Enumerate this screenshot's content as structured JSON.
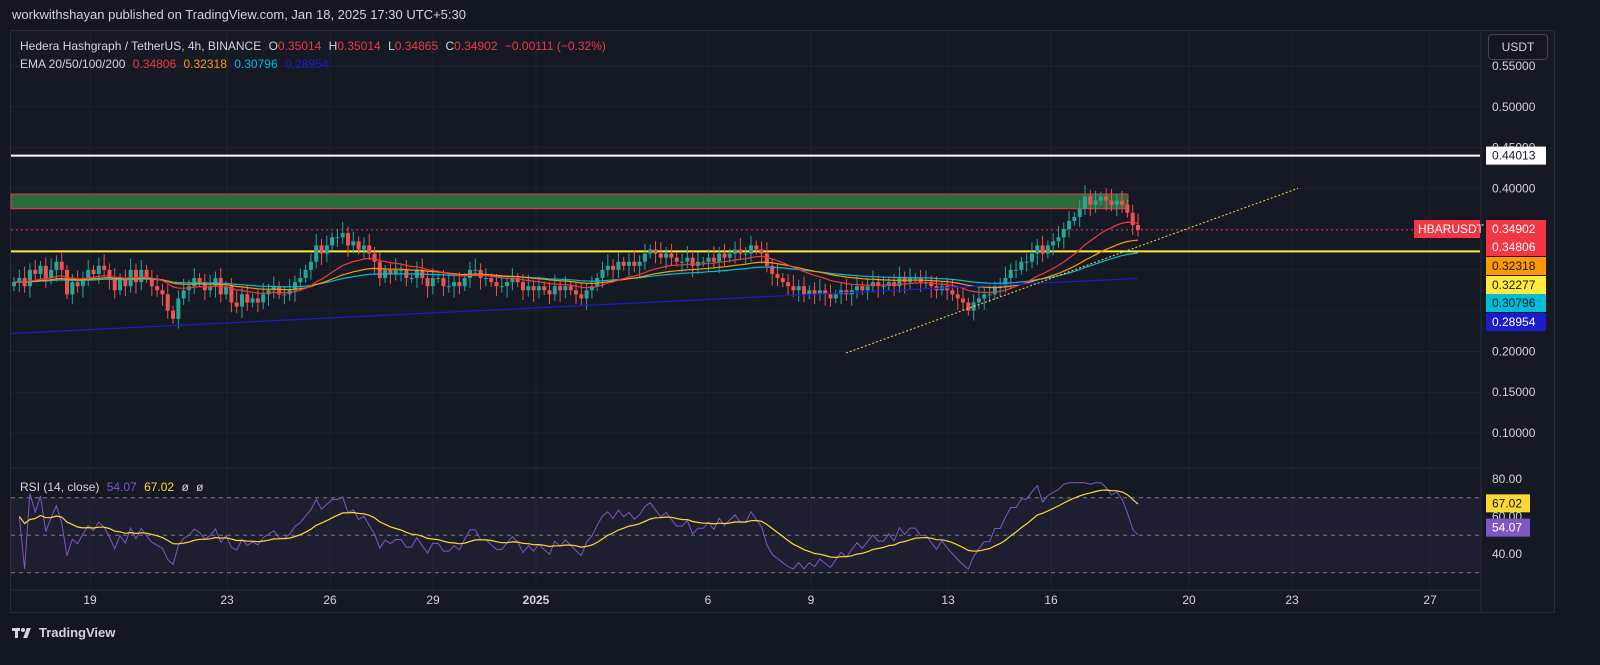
{
  "header": {
    "published_text": "workwithshayan published on TradingView.com, Jan 18, 2025 17:30 UTC+5:30"
  },
  "legend": {
    "symbol": "Hedera Hashgraph / TetherUS, 4h, BINANCE",
    "o_label": "O",
    "o_value": "0.35014",
    "h_label": "H",
    "h_value": "0.35014",
    "l_label": "L",
    "l_value": "0.34865",
    "c_label": "C",
    "c_value": "0.34902",
    "change": "−0.00111 (−0.32%)",
    "ema_label": "EMA 20/50/100/200",
    "ema20": "0.34806",
    "ema50": "0.32318",
    "ema100": "0.30796",
    "ema200": "0.28954"
  },
  "unit_button": "USDT",
  "rsi_legend": {
    "label": "RSI (14, close)",
    "rsi": "54.07",
    "ma": "67.02",
    "v3": "ø",
    "v4": "ø"
  },
  "footer": {
    "brand": "TradingView"
  },
  "colors": {
    "up": "#26a69a",
    "down": "#ef5350",
    "ema20": "#f23645",
    "ema50": "#ff9800",
    "ema100": "#00bcd4",
    "ema200": "#1c1ccf",
    "rsi": "#7e57c2",
    "rsi_ma": "#fdd835"
  },
  "chart_data": {
    "type": "candlestick",
    "x_ticks": [
      "19",
      "23",
      "26",
      "29",
      "2025",
      "6",
      "9",
      "13",
      "16",
      "20",
      "23",
      "27"
    ],
    "y_ticks": [
      "0.55000",
      "0.50000",
      "0.45000",
      "0.40000",
      "0.10000",
      "0.15000",
      "0.20000"
    ],
    "y_ticks_note": "",
    "price_axis": [
      "0.55000",
      "0.50000",
      "0.45000",
      "0.40000",
      "0.20000",
      "0.15000",
      "0.10000"
    ],
    "ylim": [
      0.07,
      0.57
    ],
    "horizontal_lines": [
      {
        "price": 0.44013,
        "label": "0.44013",
        "color": "#ffffff"
      },
      {
        "price": 0.32277,
        "label": "0.32277",
        "color": "#ffeb3b"
      }
    ],
    "resistance_zone": {
      "low": 0.375,
      "high": 0.393,
      "color": "#2e6b3a"
    },
    "trendlines": [
      {
        "from": [
          "Jan 10",
          0.198
        ],
        "to": [
          "Jan 23",
          0.4
        ],
        "color": "#ffd54f",
        "style": "dotted"
      }
    ],
    "price_labels": [
      {
        "text": "HBARUSDT",
        "value": "0.34902",
        "color": "#f23645"
      },
      {
        "text": "",
        "value": "0.34806",
        "color": "#f23645"
      },
      {
        "text": "",
        "value": "0.32318",
        "color": "#ff9800"
      },
      {
        "text": "",
        "value": "0.32277",
        "color": "#ffeb3b"
      },
      {
        "text": "",
        "value": "0.30796",
        "color": "#00bcd4"
      },
      {
        "text": "",
        "value": "0.28954",
        "color": "#1c1ccf"
      }
    ],
    "candles_close": [
      0.285,
      0.29,
      0.28,
      0.3,
      0.295,
      0.305,
      0.29,
      0.3,
      0.31,
      0.3,
      0.27,
      0.285,
      0.28,
      0.29,
      0.3,
      0.295,
      0.305,
      0.3,
      0.29,
      0.275,
      0.29,
      0.28,
      0.3,
      0.285,
      0.3,
      0.29,
      0.28,
      0.275,
      0.27,
      0.25,
      0.24,
      0.265,
      0.275,
      0.28,
      0.29,
      0.285,
      0.275,
      0.28,
      0.29,
      0.27,
      0.28,
      0.26,
      0.255,
      0.27,
      0.26,
      0.265,
      0.26,
      0.27,
      0.275,
      0.28,
      0.27,
      0.27,
      0.275,
      0.285,
      0.29,
      0.3,
      0.31,
      0.33,
      0.32,
      0.33,
      0.34,
      0.34,
      0.345,
      0.33,
      0.335,
      0.325,
      0.33,
      0.32,
      0.31,
      0.29,
      0.3,
      0.295,
      0.3,
      0.3,
      0.29,
      0.29,
      0.3,
      0.29,
      0.28,
      0.29,
      0.29,
      0.28,
      0.28,
      0.285,
      0.28,
      0.29,
      0.3,
      0.3,
      0.29,
      0.29,
      0.285,
      0.28,
      0.28,
      0.285,
      0.29,
      0.285,
      0.275,
      0.28,
      0.275,
      0.28,
      0.275,
      0.27,
      0.28,
      0.275,
      0.28,
      0.275,
      0.27,
      0.265,
      0.275,
      0.28,
      0.29,
      0.3,
      0.305,
      0.3,
      0.31,
      0.305,
      0.31,
      0.305,
      0.31,
      0.32,
      0.325,
      0.32,
      0.315,
      0.32,
      0.315,
      0.31,
      0.31,
      0.315,
      0.305,
      0.31,
      0.31,
      0.315,
      0.31,
      0.32,
      0.315,
      0.32,
      0.325,
      0.32,
      0.32,
      0.33,
      0.325,
      0.32,
      0.305,
      0.295,
      0.29,
      0.285,
      0.28,
      0.275,
      0.28,
      0.27,
      0.275,
      0.27,
      0.275,
      0.27,
      0.265,
      0.27,
      0.275,
      0.27,
      0.275,
      0.28,
      0.275,
      0.28,
      0.285,
      0.28,
      0.28,
      0.285,
      0.28,
      0.29,
      0.285,
      0.29,
      0.29,
      0.285,
      0.285,
      0.28,
      0.275,
      0.28,
      0.275,
      0.27,
      0.265,
      0.26,
      0.25,
      0.26,
      0.265,
      0.27,
      0.27,
      0.28,
      0.28,
      0.29,
      0.3,
      0.3,
      0.31,
      0.31,
      0.32,
      0.33,
      0.32,
      0.33,
      0.335,
      0.34,
      0.35,
      0.36,
      0.365,
      0.375,
      0.39,
      0.38,
      0.385,
      0.39,
      0.385,
      0.38,
      0.385,
      0.38,
      0.37,
      0.355,
      0.349
    ],
    "rsi": {
      "ylim": [
        20,
        90
      ],
      "bands": [
        30,
        50,
        70
      ],
      "ticks": [
        "80.00",
        "60.00",
        "40.00"
      ],
      "last_rsi": 54.07,
      "last_ma": 67.02
    }
  }
}
